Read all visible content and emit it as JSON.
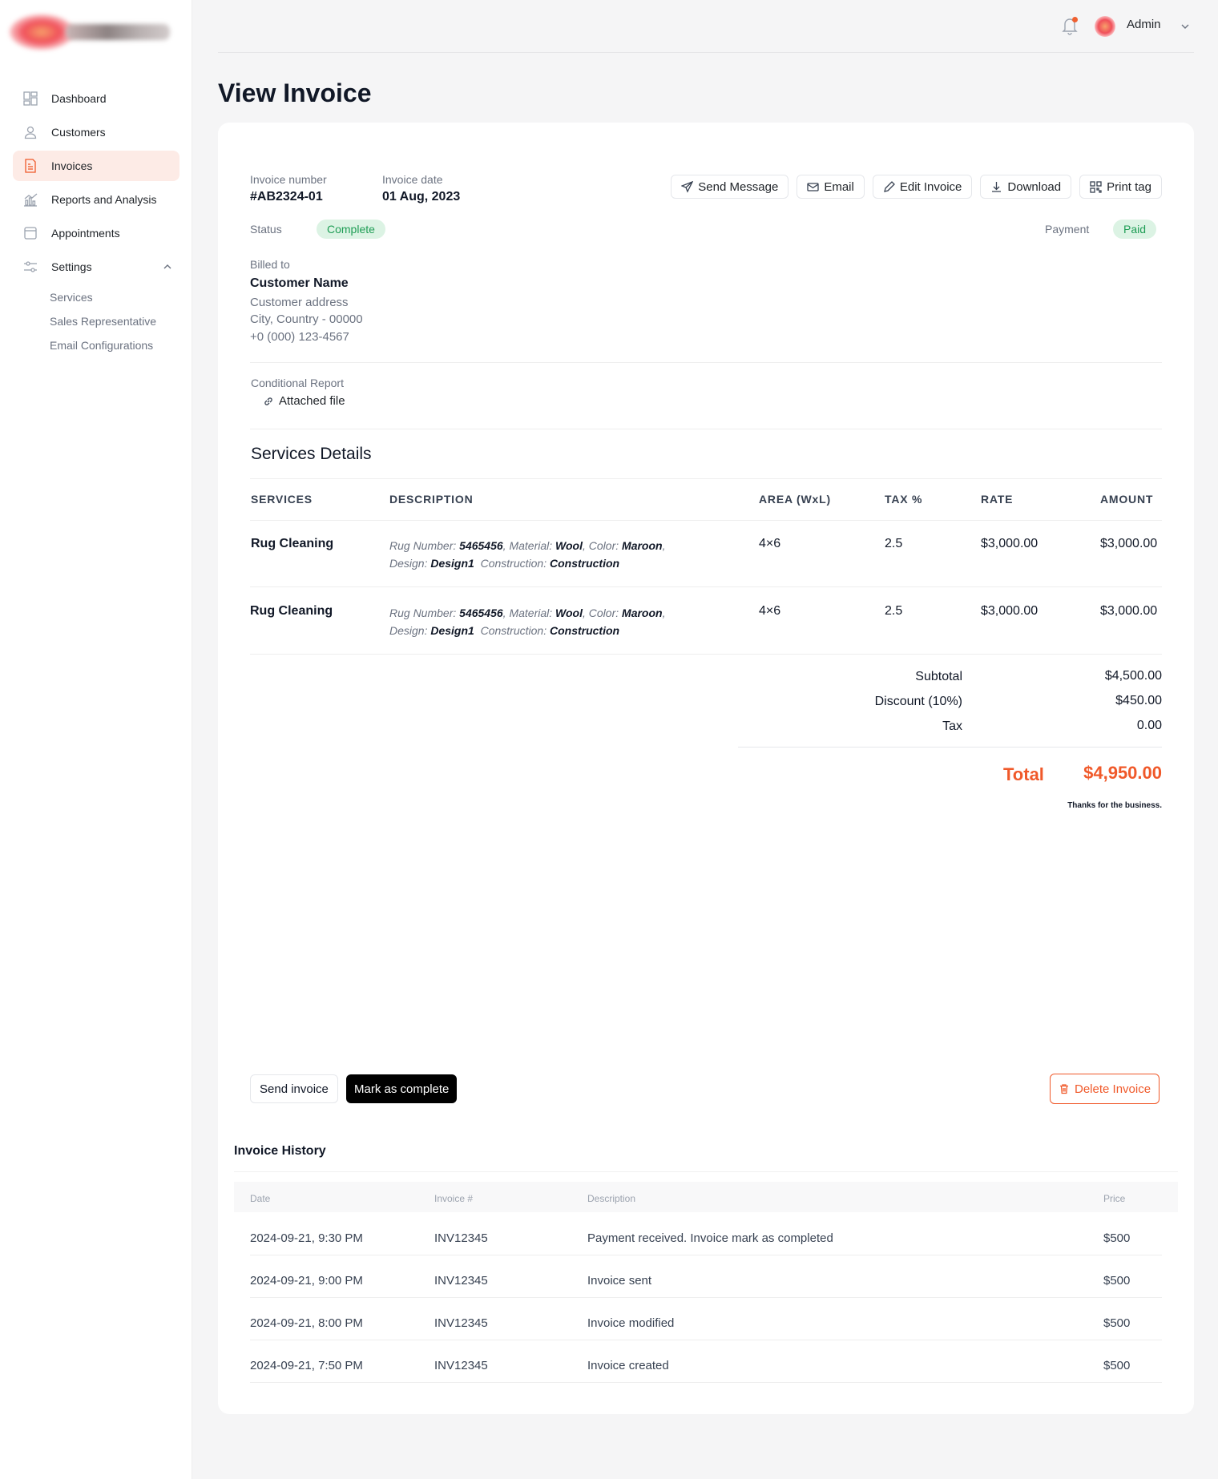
{
  "sidebar": {
    "items": [
      {
        "label": "Dashboard",
        "icon": "dashboard-icon"
      },
      {
        "label": "Customers",
        "icon": "user-icon"
      },
      {
        "label": "Invoices",
        "icon": "invoice-icon",
        "active": true
      },
      {
        "label": "Reports and Analysis",
        "icon": "chart-icon"
      },
      {
        "label": "Appointments",
        "icon": "calendar-icon"
      },
      {
        "label": "Settings",
        "icon": "sliders-icon",
        "expanded": true
      }
    ],
    "settings_sub": [
      "Services",
      "Sales Representative",
      "Email Configurations"
    ]
  },
  "header": {
    "user_name": "Admin"
  },
  "page": {
    "title": "View Invoice"
  },
  "invoice": {
    "number_label": "Invoice number",
    "number": "#AB2324-01",
    "date_label": "Invoice date",
    "date": "01 Aug, 2023",
    "status_label": "Status",
    "status": "Complete",
    "payment_label": "Payment",
    "payment": "Paid",
    "billed_to_label": "Billed to",
    "customer_name": "Customer Name",
    "customer_address": "Customer address",
    "customer_city": "City, Country - 00000",
    "customer_phone": "+0 (000) 123-4567",
    "report_label": "Conditional Report",
    "attached_file": "Attached file"
  },
  "actions": {
    "send_message": "Send Message",
    "email": "Email",
    "edit": "Edit Invoice",
    "download": "Download",
    "print": "Print tag"
  },
  "services": {
    "title": "Services Details",
    "headers": [
      "SERVICES",
      "DESCRIPTION",
      "AREA (WxL)",
      "TAX %",
      "RATE",
      "AMOUNT"
    ],
    "rows": [
      {
        "service": "Rug Cleaning",
        "rug_number_label": "Rug Number:",
        "rug_number": "5465456",
        "material_label": "Material:",
        "material": "Wool",
        "color_label": "Color:",
        "color": "Maroon",
        "design_label": "Design:",
        "design": "Design1",
        "construction_label": "Construction:",
        "construction": "Construction",
        "area": "4×6",
        "tax": "2.5",
        "rate": "$3,000.00",
        "amount": "$3,000.00"
      },
      {
        "service": "Rug Cleaning",
        "rug_number_label": "Rug Number:",
        "rug_number": "5465456",
        "material_label": "Material:",
        "material": "Wool",
        "color_label": "Color:",
        "color": "Maroon",
        "design_label": "Design:",
        "design": "Design1",
        "construction_label": "Construction:",
        "construction": "Construction",
        "area": "4×6",
        "tax": "2.5",
        "rate": "$3,000.00",
        "amount": "$3,000.00"
      }
    ]
  },
  "summary": {
    "subtotal_label": "Subtotal",
    "subtotal": "$4,500.00",
    "discount_label": "Discount (10%)",
    "discount": "$450.00",
    "tax_label": "Tax",
    "tax": "0.00",
    "total_label": "Total",
    "total": "$4,950.00",
    "thanks": "Thanks for the business."
  },
  "footer_actions": {
    "send_invoice": "Send invoice",
    "mark_complete": "Mark as complete",
    "delete": "Delete Invoice"
  },
  "history": {
    "title": "Invoice History",
    "headers": [
      "Date",
      "Invoice #",
      "Description",
      "Price"
    ],
    "rows": [
      {
        "date": "2024-09-21, 9:30 PM",
        "invoice": "INV12345",
        "description": "Payment received. Invoice mark as completed",
        "price": "$500"
      },
      {
        "date": "2024-09-21, 9:00 PM",
        "invoice": "INV12345",
        "description": "Invoice sent",
        "price": "$500"
      },
      {
        "date": "2024-09-21, 8:00 PM",
        "invoice": "INV12345",
        "description": "Invoice modified",
        "price": "$500"
      },
      {
        "date": "2024-09-21, 7:50 PM",
        "invoice": "INV12345",
        "description": "Invoice created",
        "price": "$500"
      }
    ]
  },
  "colors": {
    "accent": "#f0592a",
    "active_nav_bg": "#fdebe6",
    "success_bg": "#dcf3e4",
    "success_text": "#1f9d55"
  }
}
